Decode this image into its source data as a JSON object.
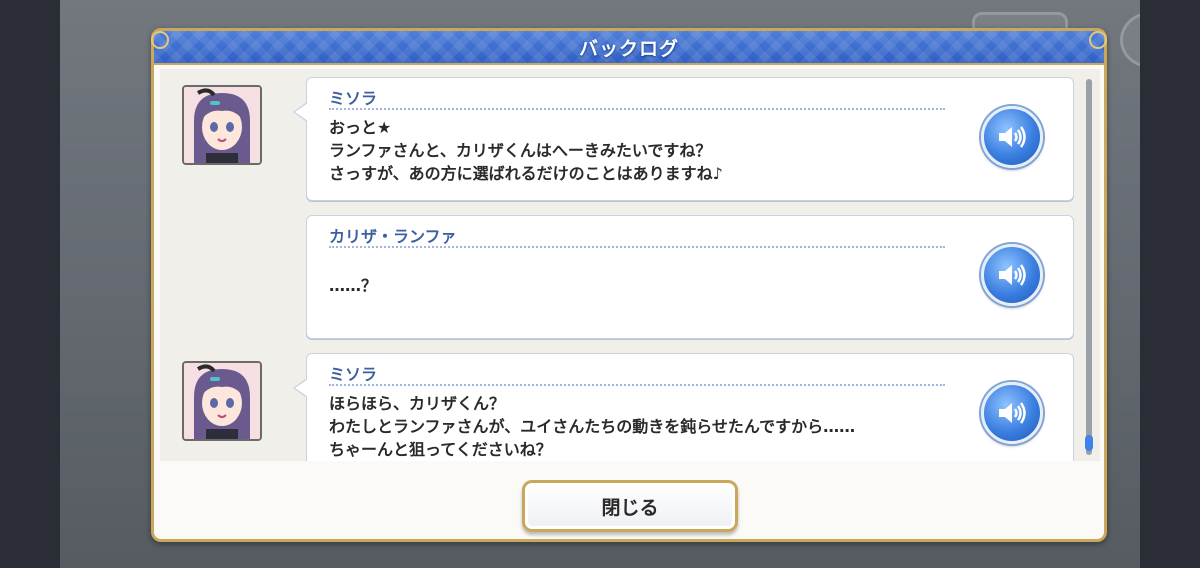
{
  "dialog": {
    "title": "バックログ",
    "close_label": "閉じる"
  },
  "entries": [
    {
      "speaker": "ミソラ",
      "has_avatar": true,
      "lines": [
        "おっと★",
        "ランファさんと、カリザくんはへーきみたいですね？",
        "さっすが、あの方に選ばれるだけのことはありますね♪"
      ]
    },
    {
      "speaker": "カリザ・ランファ",
      "has_avatar": false,
      "lines": [
        "……？"
      ]
    },
    {
      "speaker": "ミソラ",
      "has_avatar": true,
      "lines": [
        "ほらほら、カリザくん？",
        "わたしとランファさんが、ユイさんたちの動きを鈍らせたんですから……",
        "ちゃーんと狙ってくださいね？"
      ]
    }
  ],
  "icons": {
    "voice": "speaker-icon",
    "avatar": "character-portrait"
  },
  "colors": {
    "header_blue": "#2f5fc4",
    "gold_border": "#c9a85b",
    "speaker_name": "#3d5fa0",
    "voice_button": "#3b7fe0"
  }
}
